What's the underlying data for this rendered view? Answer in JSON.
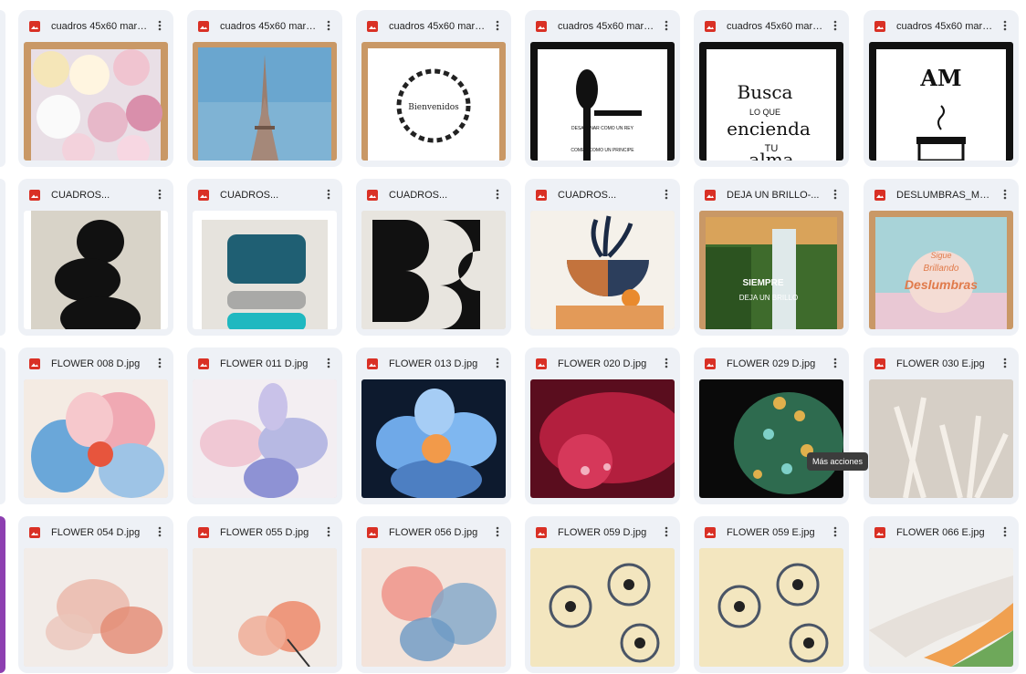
{
  "files": [
    {
      "name": "cuadros 45x60 marc...",
      "type": "image"
    },
    {
      "name": "cuadros 45x60 marc...",
      "type": "image"
    },
    {
      "name": "cuadros 45x60 marc...",
      "type": "image"
    },
    {
      "name": "cuadros 45x60 marc...",
      "type": "image"
    },
    {
      "name": "cuadros 45x60 marc...",
      "type": "image"
    },
    {
      "name": "cuadros 45x60 marc...",
      "type": "image"
    },
    {
      "name": "CUADROS...",
      "type": "image"
    },
    {
      "name": "CUADROS...",
      "type": "image"
    },
    {
      "name": "CUADROS...",
      "type": "image"
    },
    {
      "name": "CUADROS...",
      "type": "image"
    },
    {
      "name": "DEJA UN BRILLO-...",
      "type": "image"
    },
    {
      "name": "DESLUMBRAS_Mesa...",
      "type": "image"
    },
    {
      "name": "FLOWER 008 D.jpg",
      "type": "image"
    },
    {
      "name": "FLOWER 011 D.jpg",
      "type": "image"
    },
    {
      "name": "FLOWER 013 D.jpg",
      "type": "image"
    },
    {
      "name": "FLOWER 020 D.jpg",
      "type": "image"
    },
    {
      "name": "FLOWER 029 D.jpg",
      "type": "image"
    },
    {
      "name": "FLOWER 030 E.jpg",
      "type": "image"
    },
    {
      "name": "FLOWER 054 D.jpg",
      "type": "image"
    },
    {
      "name": "FLOWER 055 D.jpg",
      "type": "image"
    },
    {
      "name": "FLOWER 056 D.jpg",
      "type": "image"
    },
    {
      "name": "FLOWER 059 D.jpg",
      "type": "image"
    },
    {
      "name": "FLOWER 059 E.jpg",
      "type": "image"
    },
    {
      "name": "FLOWER 066 E.jpg",
      "type": "image"
    }
  ],
  "thumb_text": {
    "welcome": "Bienvenidos",
    "spoon1": "DESAYUNAR COMO UN REY",
    "spoon2": "COMER COMO UN PRINCIPE",
    "busca1": "Busca",
    "busca2": "LO QUE",
    "busca3": "encienda",
    "busca4": "TU",
    "busca5": "alma",
    "am": "AM",
    "siempre": "SIEMPRE",
    "deja": "DEJA UN BRILLO",
    "sigue": "Sigue",
    "brillando": "Brillando",
    "deslumbras": "Deslumbras"
  },
  "tooltip": "Más acciones",
  "colors": {
    "icon_red": "#d93025",
    "card_bg": "#eef1f6"
  }
}
